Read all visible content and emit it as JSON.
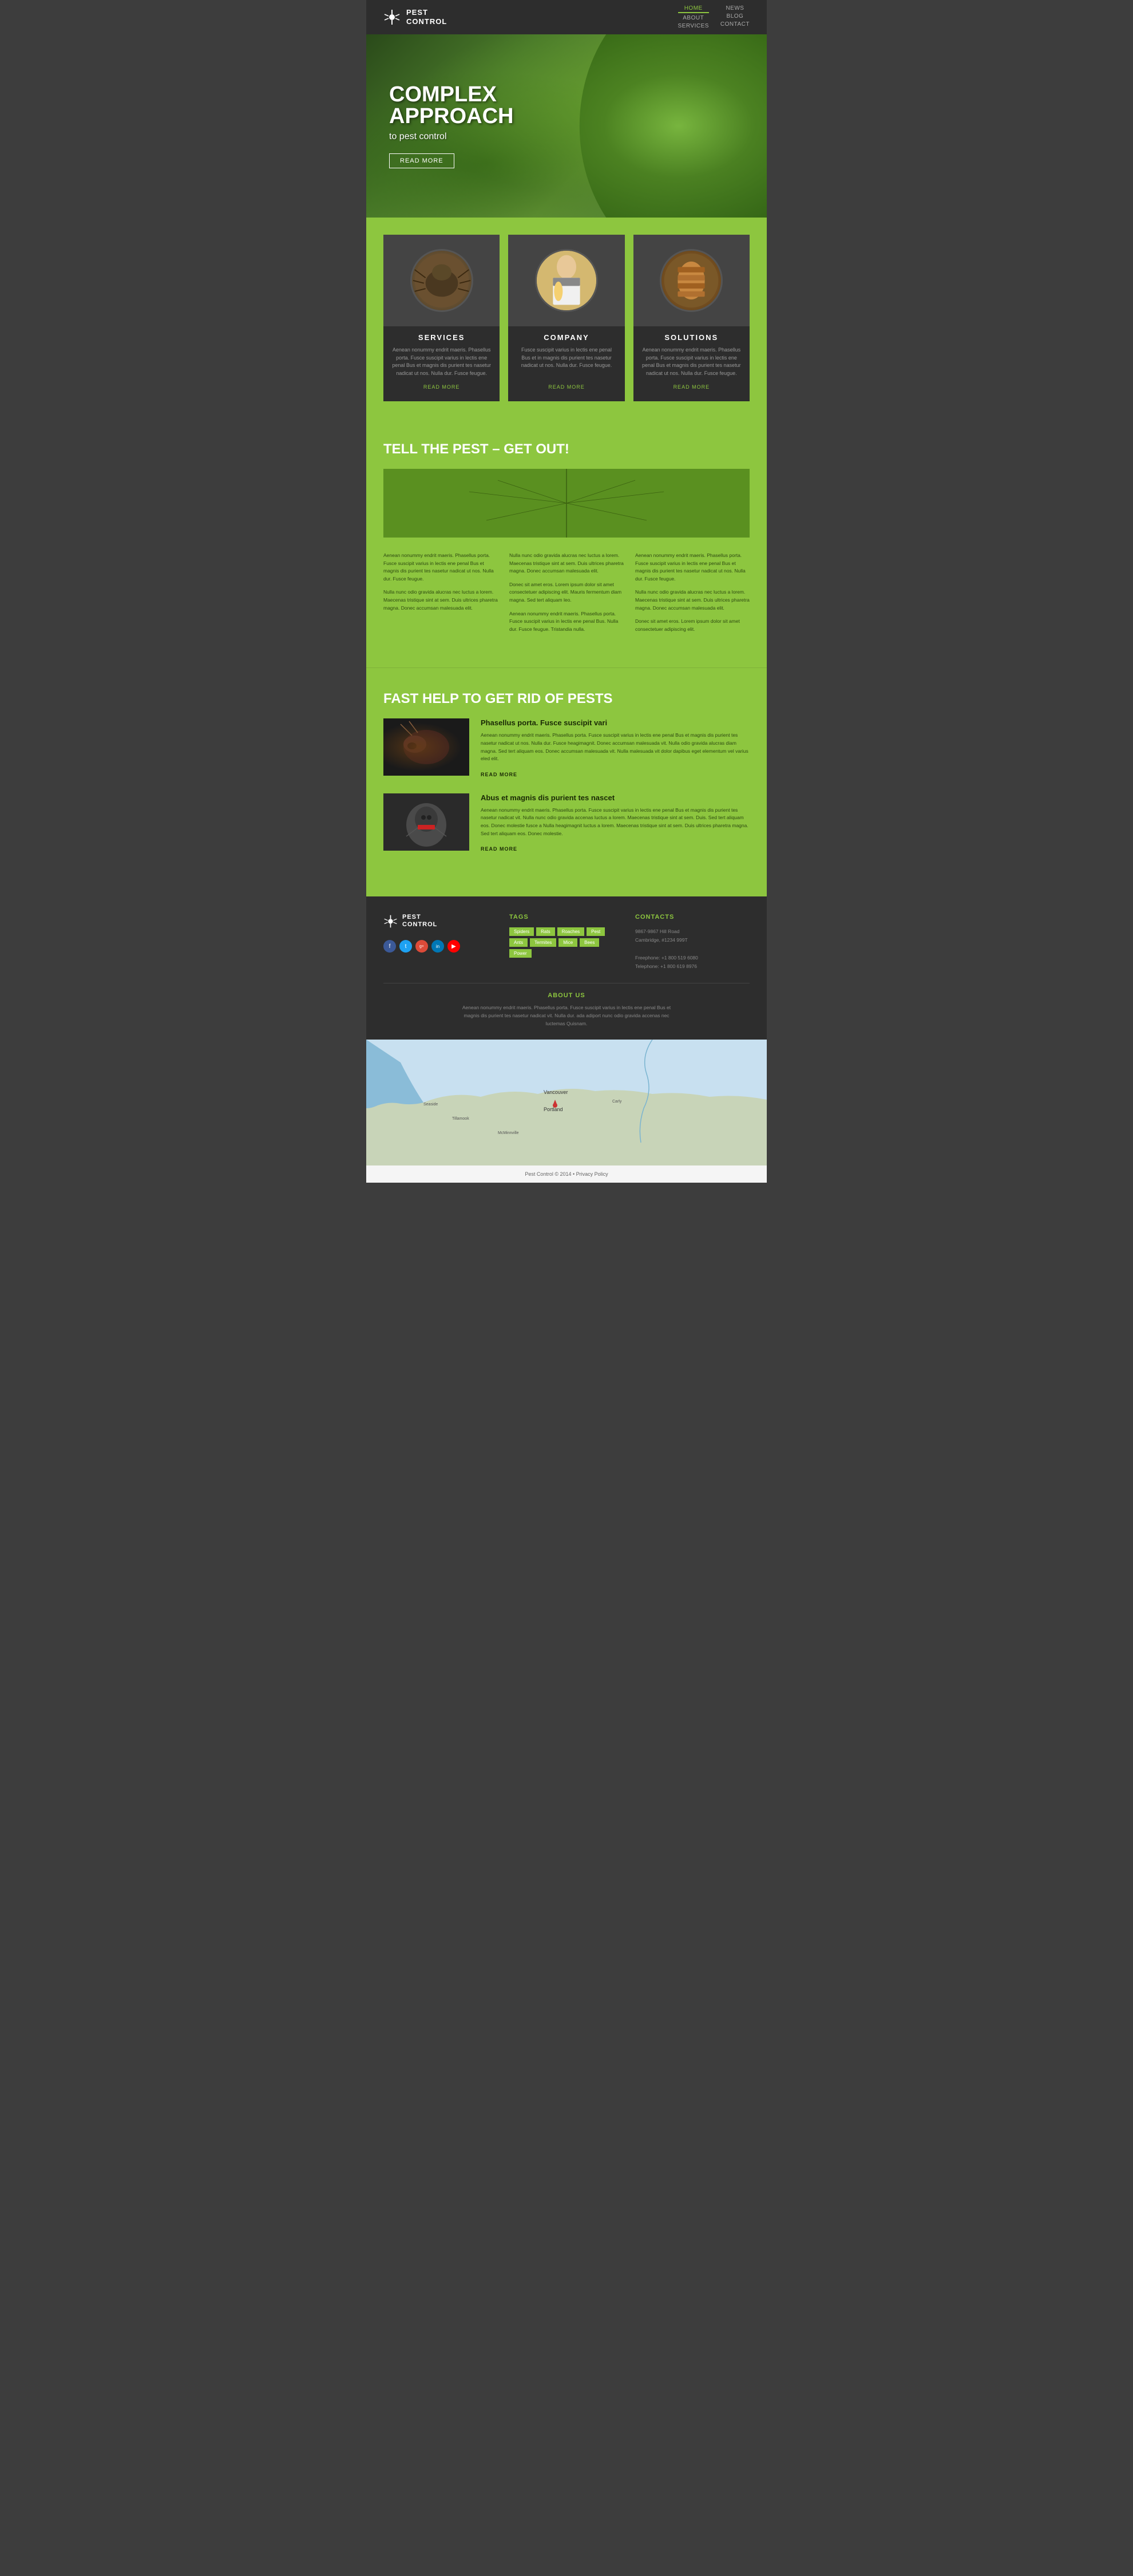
{
  "header": {
    "logo_line1": "PEST",
    "logo_line2": "CONTROL",
    "nav": {
      "col1": [
        "HOME",
        "ABOUT",
        "SERVICES"
      ],
      "col2": [
        "NEWS",
        "BLOG",
        "CONTACT"
      ]
    }
  },
  "hero": {
    "title_line1": "COMPLEX",
    "title_line2": "APPROACH",
    "subtitle": "to pest control",
    "cta": "READ MORE"
  },
  "cards": [
    {
      "title": "SERVICES",
      "text": "Aenean nonummy endrit maeris. Phasellus porta. Fusce suscipit varius in lectis ene penal Bus et magnis dis purient tes nasetur nadicat ut nos. Nulla dur. Fusce feugue.",
      "read_more": "READ MORE"
    },
    {
      "title": "COMPANY",
      "text": "Fusce suscipit varius in lectis ene penal Bus et in magnis dis purient tes nasetur nadicat ut nos. Nulla dur. Fusce feugue.",
      "read_more": "READ MORE"
    },
    {
      "title": "SOLUTIONS",
      "text": "Aenean nonummy endrit maeris. Phasellus porta. Fusce suscipit varius in lectis ene penal Bus et magnis dis purient tes nasetur nadicat ut nos. Nulla dur. Fusce feugue.",
      "read_more": "READ MORE"
    }
  ],
  "tell_pest": {
    "title": "TELL THE PEST – GET OUT!",
    "col1": {
      "p1": "Aenean nonummy endrit maeris. Phasellus porta. Fusce suscipit varius in lectis ene penal Bus et magnis dis purient tes nasetur nadicat ut nos. Nulla dur. Fusce feugue.",
      "p2": "Nulla nunc odio gravida alucras nec luctus a lorem. Maecenas tristique sint at sem. Duis ultrices pharetra magna. Donec accumsan malesuada elit."
    },
    "col2": {
      "p1": "Nulla nunc odio gravida alucras nec luctus a lorem. Maecenas tristique sint at sem. Duis ultrices pharetra magna. Donec accumsan malesuada elit.",
      "p2": "Donec sit amet eros. Lorem ipsum dolor sit amet consectetuer adipiscing elit. Mauris fermentum diam magna. Sed tert aliquam leo.",
      "p3": "Aenean nonummy endrit maeris. Phasellus porta. Fusce suscipit varius in lectis ene penal Bus. Nulla dur. Fusce feugue. Tristandia nulla."
    },
    "col3": {
      "p1": "Aenean nonummy endrit maeris. Phasellus porta. Fusce suscipit varius in lectis ene penal Bus et magnis dis purient tes nasetur nadicat ut nos. Nulla dur. Fusce feugue.",
      "p2": "Nulla nunc odio gravida alucras nec luctus a lorem. Maecenas tristique sint at sem. Duis ultrices pharetra magna. Donec accumsan malesuada elit.",
      "p3": "Donec sit amet eros. Lorem ipsum dolor sit amet consectetuer adipiscing elit."
    }
  },
  "fast_help": {
    "title": "FAST HELP TO GET RID OF PESTS",
    "articles": [
      {
        "title": "Phasellus porta. Fusce suscipit vari",
        "text": "Aenean nonummy endrit maeris. Phasellus porta. Fusce suscipit varius in lectis ene penal Bus et magnis dis purient tes nasetur nadicat ut nos. Nulla dur. Fusce heagimagnit. Donec accumsan malesuada vit. Nulla odio gravida alucras diam magna. Sed tert aliquam eos. Donec accumsan malesuada vit. Nulla malesuada vit dolor dapibus eget elementum vel varius eled elit.",
        "read_more": "READ MORE"
      },
      {
        "title": "Abus et magnis dis purient tes nascet",
        "text": "Aenean nonummy endrit maeris. Phasellus porta. Fusce suscipit varius in lectis ene penal Bus et magnis dis purient tes nasetur nadicat vit. Nulla nunc odio gravida accenas luctus a lorem. Maecenas tristique sint at sem. Duis. Sed tert aliquam eos. Donec molestie fusce a Nulla heagimagnit luctus a lorem. Maecenas tristique sint at sem. Duis ultrices pharetra magna. Sed tert aliquam eos. Donec molestie.",
        "read_more": "READ MORE"
      }
    ]
  },
  "footer": {
    "logo_line1": "PEST",
    "logo_line2": "CONTROL",
    "social": [
      "f",
      "t",
      "g+",
      "in",
      "▶"
    ],
    "tags_title": "TAGS",
    "tags": [
      "Spiders",
      "Rats",
      "Roaches",
      "Pest",
      "Ants",
      "Termites",
      "Mice",
      "Bees",
      "Power"
    ],
    "contacts_title": "CONTACTS",
    "contacts": {
      "address": "9867-9867 Hill Road",
      "city": "Cambridge, #1234 999T",
      "freephone": "Freephone: +1 800 519 6080",
      "telephone": "Telephone: +1 800 619 8976"
    },
    "about_title": "ABOUT US",
    "about_text": "Aenean nonummy endrit maeris. Phasellus porta. Fusce suscipit varius in lectis ene penal Bus et magnis dis purient tes nasetur nadicat vit. Nulla dur. ada adiport nunc odio gravida accenas nec luctemas Quisnam."
  },
  "map": {
    "label_vancouver": "Vancouver",
    "label_portland": "Portland"
  },
  "copyright": {
    "text": "Pest Control © 2014 • Privacy Policy"
  }
}
